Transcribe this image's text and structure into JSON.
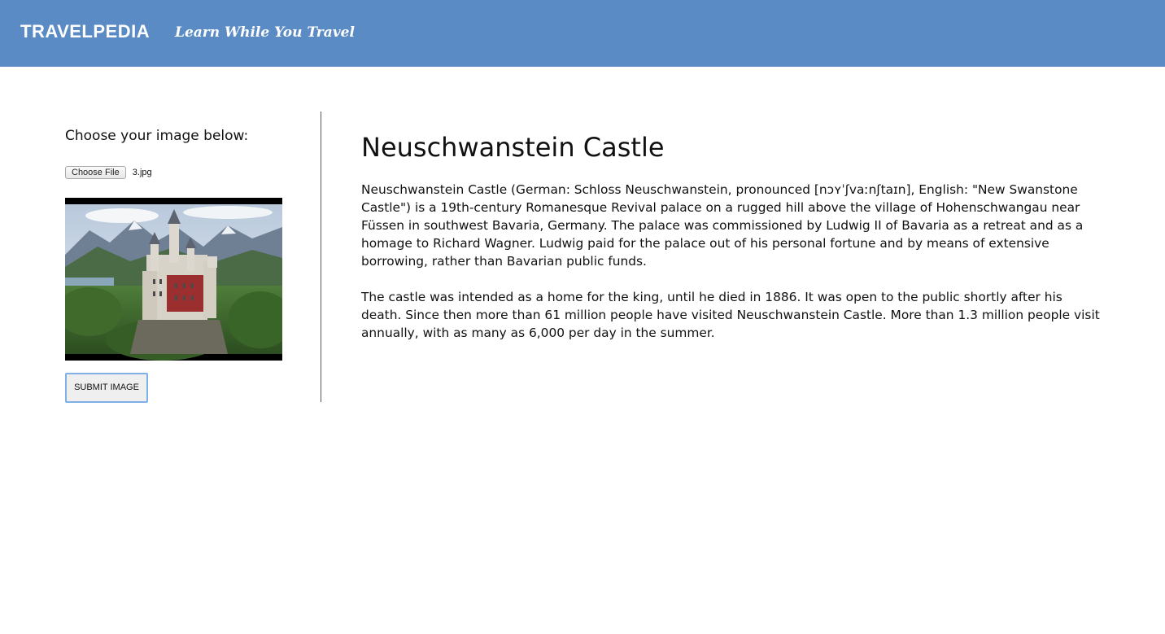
{
  "header": {
    "brand": "TRAVELPEDIA",
    "tagline": "Learn While You Travel",
    "background_color": "#5b8bc4"
  },
  "upload": {
    "label": "Choose your image below:",
    "choose_file_label": "Choose File",
    "file_name": "3.jpg",
    "preview_alt": "Neuschwanstein Castle",
    "submit_label": "SUBMIT IMAGE"
  },
  "article": {
    "title": "Neuschwanstein Castle",
    "paragraphs": [
      "Neuschwanstein Castle (German: Schloss Neuschwanstein, pronounced [nɔʏˈʃvaːnʃtaɪn], English: \"New Swanstone Castle\") is a 19th-century Romanesque Revival palace on a rugged hill above the village of Hohenschwangau near Füssen in southwest Bavaria, Germany. The palace was commissioned by Ludwig II of Bavaria as a retreat and as a homage to Richard Wagner. Ludwig paid for the palace out of his personal fortune and by means of extensive borrowing, rather than Bavarian public funds.",
      "The castle was intended as a home for the king, until he died in 1886. It was open to the public shortly after his death. Since then more than 61 million people have visited Neuschwanstein Castle. More than 1.3 million people visit annually, with as many as 6,000 per day in the summer."
    ]
  }
}
